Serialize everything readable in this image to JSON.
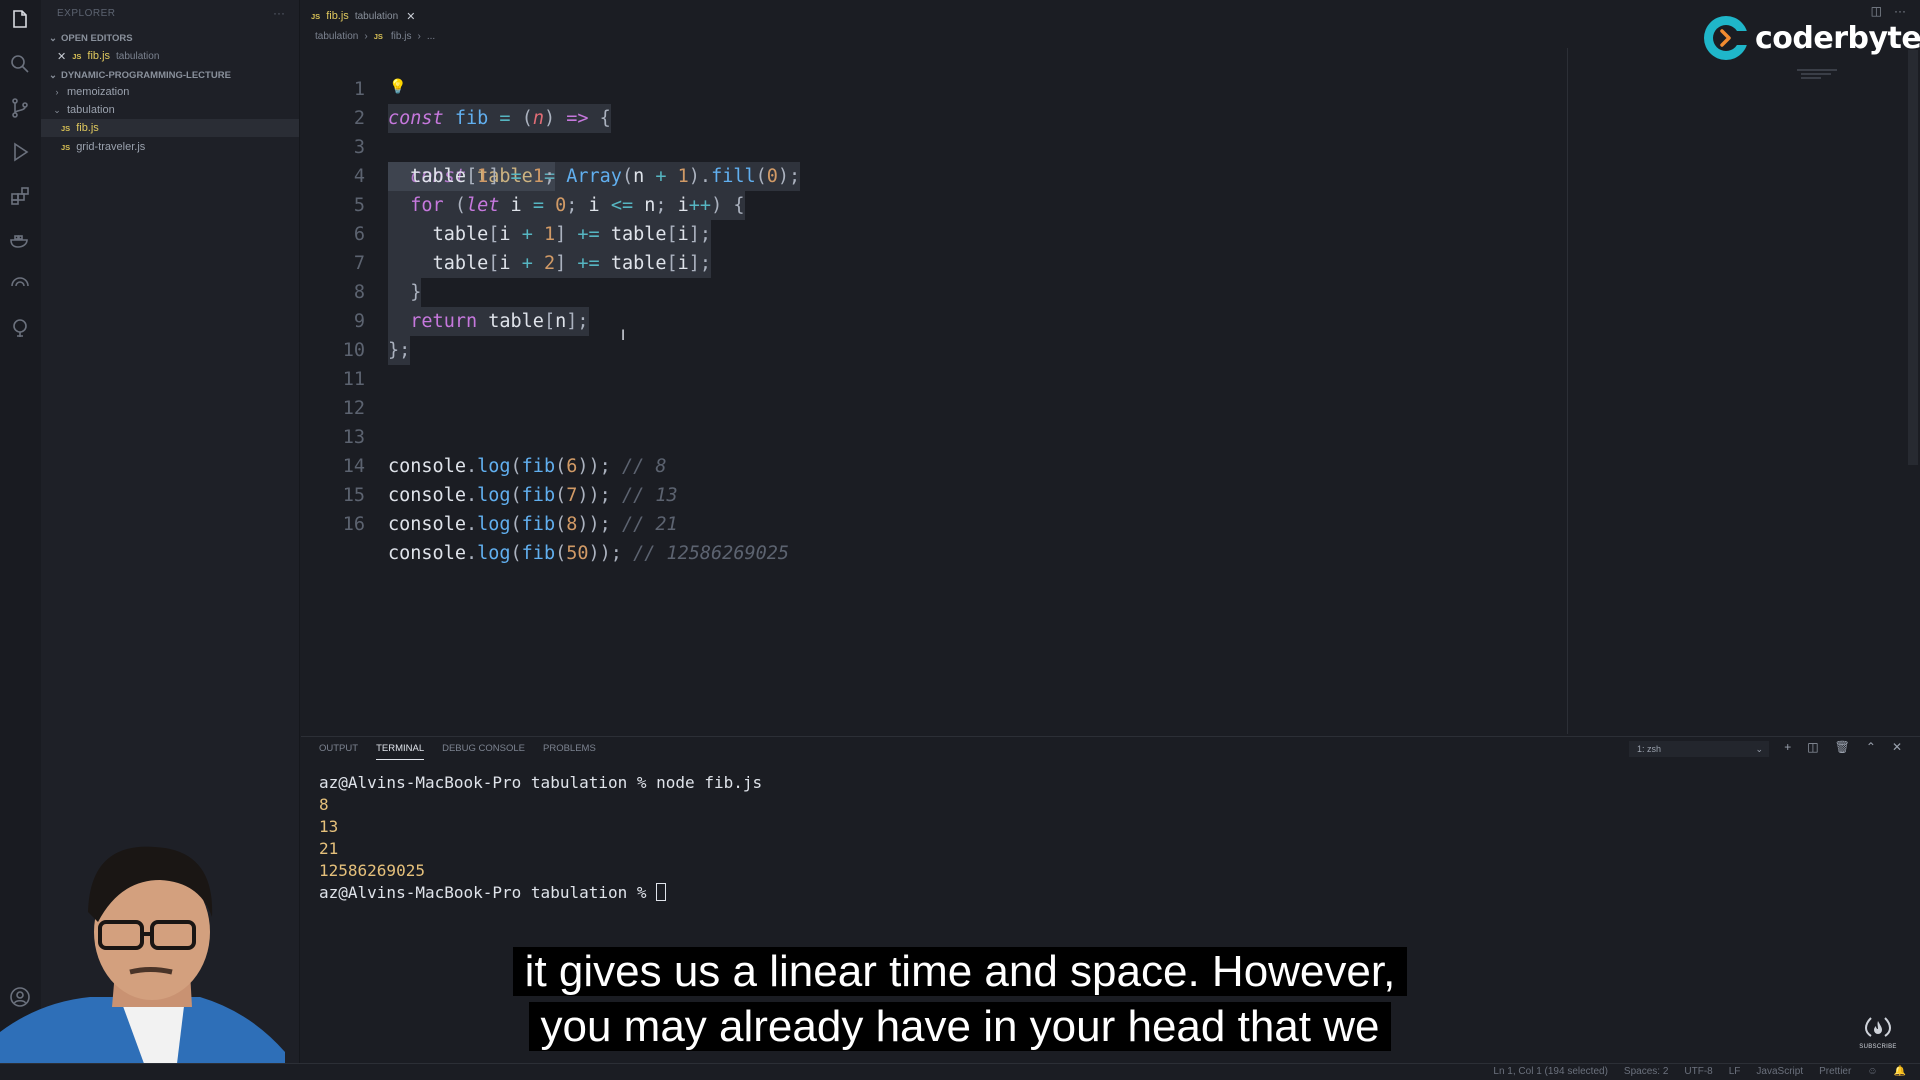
{
  "window": {
    "tab_file": "fib.js",
    "tab_folder": "tabulation"
  },
  "sidebar": {
    "title": "EXPLORER",
    "more": "···",
    "open_editors_label": "OPEN EDITORS",
    "open_editor": {
      "name": "fib.js",
      "folder": "tabulation"
    },
    "project_label": "DYNAMIC-PROGRAMMING-LECTURE",
    "items": [
      {
        "label": "memoization",
        "chevron": "›"
      },
      {
        "label": "tabulation",
        "chevron": "⌄"
      },
      {
        "label": "fib.js"
      },
      {
        "label": "grid-traveler.js"
      }
    ],
    "js_badge": "JS"
  },
  "breadcrumb": {
    "folder": "tabulation",
    "file": "fib.js",
    "ellipsis": "..."
  },
  "editor": {
    "line_numbers": [
      "1",
      "2",
      "3",
      "4",
      "5",
      "6",
      "7",
      "8",
      "9",
      "10",
      "11",
      "12",
      "13",
      "14",
      "15",
      "16"
    ],
    "comments": [
      "// 8",
      "// 13",
      "// 21",
      "// 12586269025"
    ]
  },
  "panel": {
    "tabs": [
      "OUTPUT",
      "TERMINAL",
      "DEBUG CONSOLE",
      "PROBLEMS"
    ],
    "active_tab": "TERMINAL",
    "terminal_select": "1: zsh",
    "prompt": "az@Alvins-MacBook-Pro tabulation % ",
    "command": "node fib.js",
    "outputs": [
      "8",
      "13",
      "21",
      "12586269025"
    ]
  },
  "statusbar": {
    "cursor": "Ln 1, Col 1 (194 selected)",
    "spaces": "Spaces: 2",
    "encoding": "UTF-8",
    "eol": "LF",
    "language": "JavaScript",
    "formatter": "Prettier"
  },
  "caption": {
    "line1": "it gives us a linear time and space. However,",
    "line2": "you may already have in your head that we"
  },
  "brand": {
    "name": "coderbyte",
    "color": "#1fb6c9"
  },
  "channel_badge": "SUBSCRIBE",
  "icons": [
    "files-icon",
    "search-icon",
    "source-control-icon",
    "run-debug-icon",
    "extensions-icon",
    "docker-icon",
    "remote-icon",
    "git-graph-icon",
    "account-icon",
    "settings-icon"
  ]
}
